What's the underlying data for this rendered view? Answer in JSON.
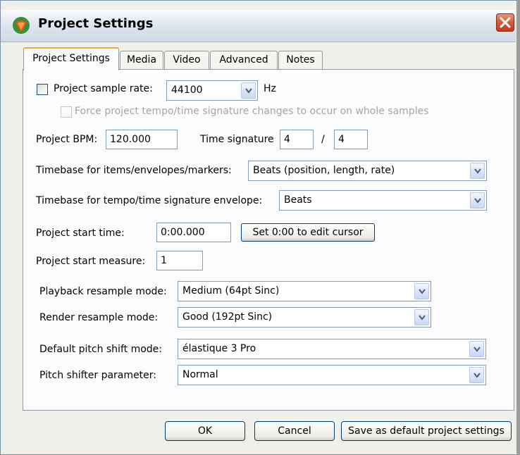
{
  "window": {
    "title": "Project Settings",
    "app_icon": "reaper-logo-icon",
    "close_icon": "close-icon"
  },
  "tabs": [
    {
      "label": "Project Settings",
      "active": true
    },
    {
      "label": "Media",
      "active": false
    },
    {
      "label": "Video",
      "active": false
    },
    {
      "label": "Advanced",
      "active": false
    },
    {
      "label": "Notes",
      "active": false
    }
  ],
  "sample_rate": {
    "checkbox_label": "Project sample rate:",
    "checked": false,
    "value": "44100",
    "unit": "Hz",
    "force_label": "Force project tempo/time signature changes to occur on whole samples"
  },
  "bpm": {
    "label": "Project BPM:",
    "value": "120.000"
  },
  "time_signature": {
    "label": "Time signature",
    "numerator": "4",
    "separator": "/",
    "denominator": "4"
  },
  "timebase_items": {
    "label": "Timebase for items/envelopes/markers:",
    "value": "Beats (position, length, rate)"
  },
  "timebase_tempo": {
    "label": "Timebase for tempo/time signature envelope:",
    "value": "Beats"
  },
  "start_time": {
    "label": "Project start time:",
    "value": "0:00.000",
    "button_label": "Set 0:00 to edit cursor"
  },
  "start_measure": {
    "label": "Project start measure:",
    "value": "1"
  },
  "playback_resample": {
    "label": "Playback resample mode:",
    "value": "Medium (64pt Sinc)"
  },
  "render_resample": {
    "label": "Render resample mode:",
    "value": "Good (192pt Sinc)"
  },
  "pitch_shift": {
    "label": "Default pitch shift mode:",
    "value": "élastique 3 Pro"
  },
  "pitch_param": {
    "label": "Pitch shifter parameter:",
    "value": "Normal"
  },
  "footer": {
    "ok_label": "OK",
    "cancel_label": "Cancel",
    "save_default_label": "Save as default project settings"
  },
  "colors": {
    "tab_highlight": "#f2a43c",
    "close_button": "#d55b3a",
    "dialog_bg": "#f0f0ea"
  }
}
